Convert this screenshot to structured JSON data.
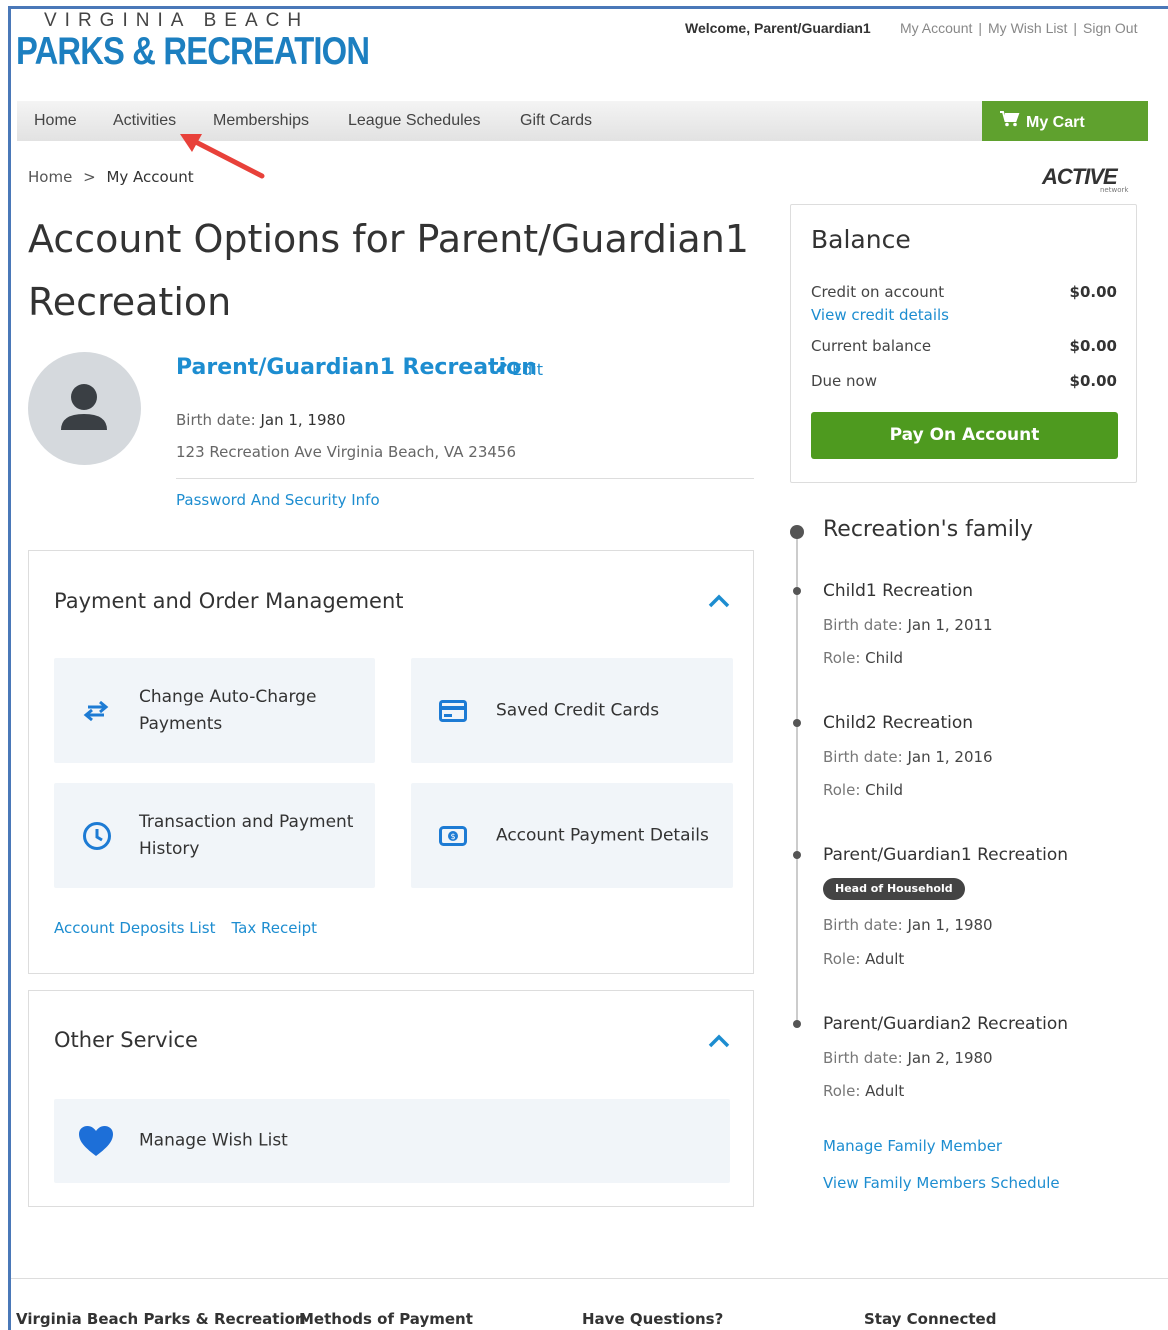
{
  "header": {
    "logo_top": "VIRGINIA BEACH",
    "logo_main": "PARKS & RECREATION",
    "welcome": "Welcome, Parent/Guardian1",
    "links": [
      "My Account",
      "My Wish List",
      "Sign Out"
    ],
    "link_separator": "|"
  },
  "nav": {
    "items": [
      "Home",
      "Activities",
      "Memberships",
      "League Schedules",
      "Gift Cards"
    ],
    "cart_label": "My Cart"
  },
  "breadcrumb": {
    "home": "Home",
    "sep": ">",
    "current": "My Account"
  },
  "brand": {
    "active": "ACTIVE",
    "active_sub": "network"
  },
  "page_title": "Account Options for Parent/Guardian1 Recreation",
  "profile": {
    "name": "Parent/Guardian1 Recreation",
    "edit_label": "Edit",
    "birth_label": "Birth date:",
    "birth_value": "Jan 1, 1980",
    "address": "123 Recreation Ave Virginia Beach, VA 23456",
    "password_link": "Password And Security Info"
  },
  "payment_panel": {
    "title": "Payment and Order Management",
    "tiles": [
      "Change Auto-Charge Payments",
      "Saved Credit Cards",
      "Transaction and Payment History",
      "Account Payment Details"
    ],
    "links": [
      "Account Deposits List",
      "Tax Receipt"
    ]
  },
  "other_panel": {
    "title": "Other Service",
    "tiles": [
      "Manage Wish List"
    ]
  },
  "balance": {
    "title": "Balance",
    "credit_label": "Credit on account",
    "credit_value": "$0.00",
    "credit_link": "View credit details",
    "current_label": "Current balance",
    "current_value": "$0.00",
    "due_label": "Due now",
    "due_value": "$0.00",
    "pay_button": "Pay On Account"
  },
  "family": {
    "title": "Recreation's family",
    "birth_label": "Birth date:",
    "role_label": "Role:",
    "members": [
      {
        "name": "Child1 Recreation",
        "birth": "Jan 1, 2011",
        "role": "Child"
      },
      {
        "name": "Child2 Recreation",
        "birth": "Jan 1, 2016",
        "role": "Child"
      },
      {
        "name": "Parent/Guardian1 Recreation",
        "badge": "Head of Household",
        "birth": "Jan 1, 1980",
        "role": "Adult"
      },
      {
        "name": "Parent/Guardian2 Recreation",
        "birth": "Jan 2, 1980",
        "role": "Adult"
      }
    ],
    "links": [
      "Manage Family Member",
      "View Family Members Schedule"
    ]
  },
  "footer": {
    "columns": [
      "Virginia Beach Parks & Recreation",
      "Methods of Payment",
      "Have Questions?",
      "Stay Connected"
    ]
  },
  "colors": {
    "brand_blue": "#1c7fc0",
    "link_blue": "#1d8dd0",
    "cart_green": "#5fa12e",
    "pay_green": "#4e9a1f",
    "arrow_red": "#e8413a"
  }
}
